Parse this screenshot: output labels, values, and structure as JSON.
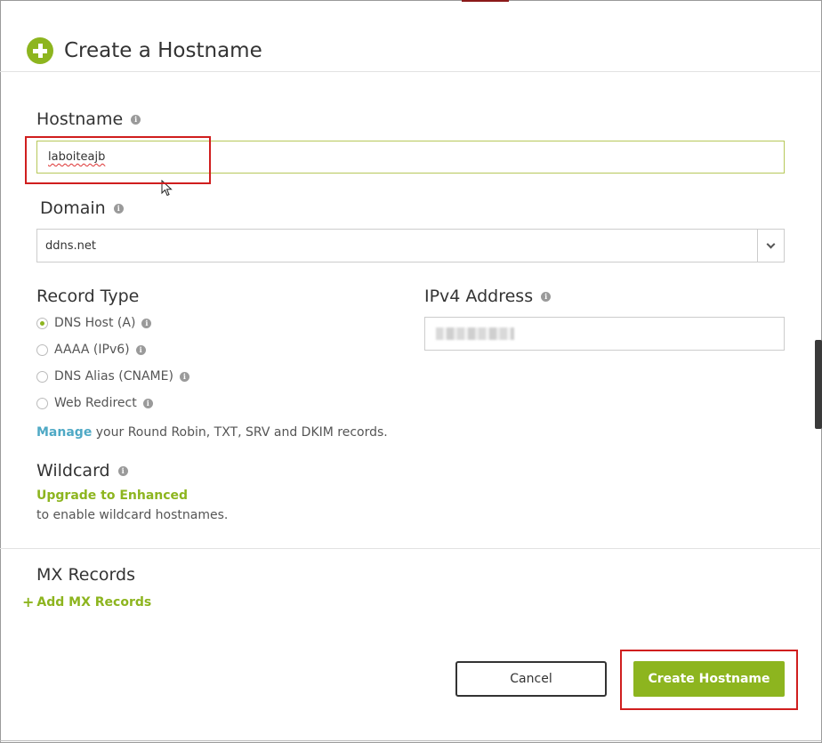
{
  "dialog": {
    "title": "Create a Hostname"
  },
  "hostname": {
    "label": "Hostname",
    "value": "laboiteajb"
  },
  "domain": {
    "label": "Domain",
    "selected": "ddns.net"
  },
  "record_type": {
    "label": "Record Type",
    "options": [
      {
        "label": "DNS Host (A)",
        "checked": true
      },
      {
        "label": "AAAA (IPv6)",
        "checked": false
      },
      {
        "label": "DNS Alias (CNAME)",
        "checked": false
      },
      {
        "label": "Web Redirect",
        "checked": false
      }
    ],
    "manage_link": "Manage",
    "manage_text": " your Round Robin, TXT, SRV and DKIM records."
  },
  "ipv4": {
    "label": "IPv4 Address"
  },
  "wildcard": {
    "label": "Wildcard",
    "upgrade_link": "Upgrade to Enhanced",
    "note": "to enable wildcard hostnames."
  },
  "mx": {
    "label": "MX Records",
    "add_link": "Add MX Records"
  },
  "buttons": {
    "cancel": "Cancel",
    "create": "Create Hostname"
  },
  "colors": {
    "accent_green": "#8db51f",
    "link_blue": "#4fa9c5",
    "annotation_red": "#d01e1e"
  }
}
